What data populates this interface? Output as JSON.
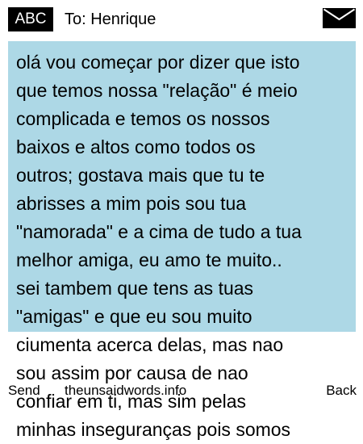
{
  "header": {
    "input_mode": "ABC",
    "recipient": "To: Henrique",
    "envelope_icon": "envelope-icon"
  },
  "message": {
    "text": "olá vou começar por dizer que isto\nque temos nossa \"relação\" é meio\ncomplicada e temos os nossos\nbaixos e altos como todos os\noutros; gostava mais que tu te\nabrisses a mim pois sou tua\n\"namorada\" e a cima de tudo a tua\nmelhor amiga, eu amo te muito..\nsei tambem que tens as tuas\n\"amigas\" e que eu sou muito\nciumenta acerca delas, mas nao\nsou assim por causa de nao\nconfiar em ti, mas sim pelas\nminhas inseguranças pois somos"
  },
  "softkeys": {
    "left": "Send",
    "center": "theunsaidwords.info",
    "right": "Back"
  },
  "colors": {
    "highlight": "#add8e6",
    "badge": "#000000"
  }
}
